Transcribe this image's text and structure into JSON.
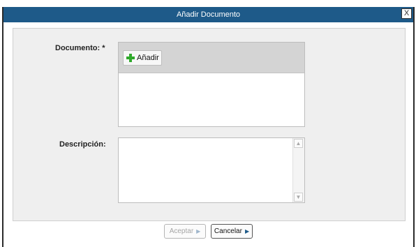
{
  "dialog": {
    "title": "Añadir Documento",
    "close_glyph": "X"
  },
  "form": {
    "document_label": "Documento: *",
    "add_button_label": "Añadir",
    "description_label": "Descripción:",
    "description_value": ""
  },
  "footer": {
    "accept_label": "Aceptar",
    "cancel_label": "Cancelar"
  },
  "icons": {
    "add": "plus-icon",
    "close": "close-icon",
    "scroll_up": "scroll-up-arrow-icon",
    "scroll_down": "scroll-down-arrow-icon",
    "accept_arrow": "chevron-right-icon",
    "cancel_arrow": "chevron-right-icon"
  },
  "colors": {
    "titlebar": "#1e5a89",
    "add_icon": "#2fa92b",
    "panel": "#efefef",
    "disabled_text": "#a5a5a5"
  }
}
